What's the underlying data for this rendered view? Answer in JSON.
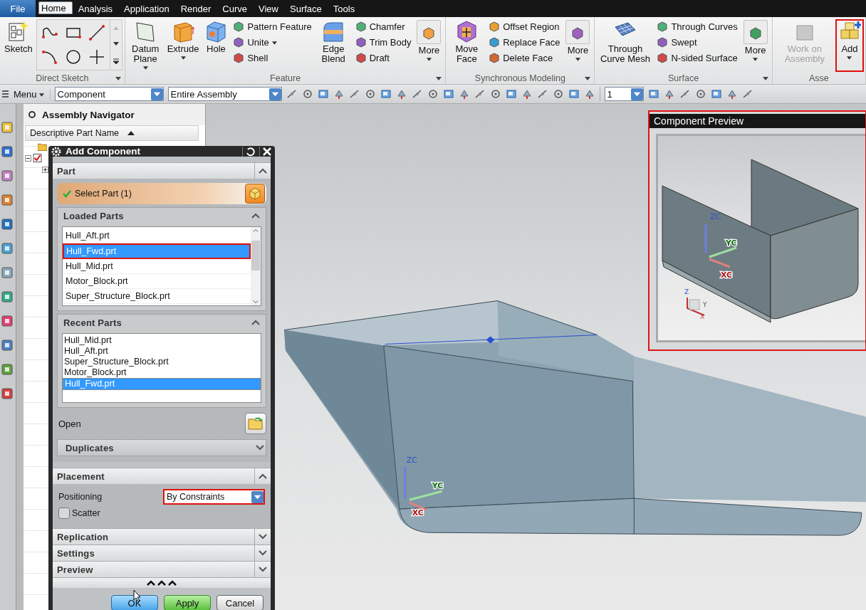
{
  "menu_tabs": [
    {
      "label": "File",
      "kind": "file",
      "selected": false
    },
    {
      "label": "Home",
      "kind": "tab",
      "selected": true
    },
    {
      "label": "Analysis",
      "kind": "tab",
      "selected": false
    },
    {
      "label": "Application",
      "kind": "tab",
      "selected": false
    },
    {
      "label": "Render",
      "kind": "tab",
      "selected": false
    },
    {
      "label": "Curve",
      "kind": "tab",
      "selected": false
    },
    {
      "label": "View",
      "kind": "tab",
      "selected": false
    },
    {
      "label": "Surface",
      "kind": "tab",
      "selected": false
    },
    {
      "label": "Tools",
      "kind": "tab",
      "selected": false
    }
  ],
  "ribbon": [
    {
      "label": "Direct Sketch",
      "items": [
        {
          "kind": "large",
          "label": "Sketch",
          "dropdown": false,
          "disabled": false,
          "highlighted": false
        },
        {
          "kind": "sketch_tools"
        }
      ]
    },
    {
      "label": "Feature",
      "items": [
        {
          "kind": "large",
          "label": "Datum Plane",
          "dropdown": true,
          "disabled": false,
          "highlighted": false
        },
        {
          "kind": "large",
          "label": "Extrude",
          "dropdown": true,
          "disabled": false,
          "highlighted": false
        },
        {
          "kind": "large",
          "label": "Hole",
          "dropdown": false,
          "disabled": false,
          "highlighted": false
        },
        {
          "kind": "stack",
          "items": [
            {
              "label": "Pattern Feature",
              "dropdown": false
            },
            {
              "label": "Unite",
              "dropdown": true
            },
            {
              "label": "Shell",
              "dropdown": false
            }
          ]
        },
        {
          "kind": "large",
          "label": "Edge Blend",
          "dropdown": false,
          "disabled": false,
          "highlighted": false
        },
        {
          "kind": "stack",
          "items": [
            {
              "label": "Chamfer",
              "dropdown": false
            },
            {
              "label": "Trim Body",
              "dropdown": false
            },
            {
              "label": "Draft",
              "dropdown": false
            }
          ]
        },
        {
          "kind": "more",
          "label": "More"
        }
      ]
    },
    {
      "label": "Synchronous Modeling",
      "items": [
        {
          "kind": "large",
          "label": "Move Face",
          "dropdown": false,
          "disabled": false,
          "highlighted": false
        },
        {
          "kind": "stack",
          "items": [
            {
              "label": "Offset Region",
              "dropdown": false
            },
            {
              "label": "Replace Face",
              "dropdown": false
            },
            {
              "label": "Delete Face",
              "dropdown": false
            }
          ]
        },
        {
          "kind": "more",
          "label": "More"
        }
      ]
    },
    {
      "label": "Surface",
      "items": [
        {
          "kind": "large",
          "label": "Through Curve Mesh",
          "dropdown": false,
          "disabled": false,
          "highlighted": false
        },
        {
          "kind": "stack",
          "items": [
            {
              "label": "Through Curves",
              "dropdown": false
            },
            {
              "label": "Swept",
              "dropdown": false
            },
            {
              "label": "N-sided Surface",
              "dropdown": false
            }
          ]
        },
        {
          "kind": "more",
          "label": "More"
        }
      ]
    },
    {
      "label": "Asse",
      "items": [
        {
          "kind": "large",
          "label": "Work on Assembly",
          "dropdown": false,
          "disabled": true,
          "highlighted": false
        },
        {
          "kind": "large",
          "label": "Add",
          "dropdown": true,
          "disabled": false,
          "highlighted": true
        }
      ]
    }
  ],
  "toolbar": {
    "menu": "Menu",
    "selection_filter": "Component",
    "scope": "Entire Assembly",
    "layer": "1"
  },
  "navigator": {
    "title": "Assembly Navigator",
    "column": "Descriptive Part Name",
    "rows": [
      {
        "kind": "folder"
      },
      {
        "kind": "part",
        "checked": true,
        "expanded": true,
        "children": [
          {
            "kind": "part",
            "expanded": false
          }
        ]
      }
    ]
  },
  "dialog": {
    "title": "Add Component",
    "sections": [
      {
        "kind": "part",
        "title": "Part",
        "expanded": true,
        "select": {
          "label": "Select Part (1)",
          "done": true
        },
        "loaded": {
          "title": "Loaded Parts",
          "expanded": true,
          "items": [
            {
              "label": "Hull_Aft.prt",
              "selected": false,
              "highlighted": false
            },
            {
              "label": "Hull_Fwd.prt",
              "selected": true,
              "highlighted": true
            },
            {
              "label": "Hull_Mid.prt",
              "selected": false,
              "highlighted": false
            },
            {
              "label": "Motor_Block.prt",
              "selected": false,
              "highlighted": false
            },
            {
              "label": "Super_Structure_Block.prt",
              "selected": false,
              "highlighted": false
            }
          ]
        },
        "recent": {
          "title": "Recent Parts",
          "expanded": true,
          "items": [
            {
              "label": "Hull_Mid.prt",
              "selected": false
            },
            {
              "label": "Hull_Aft.prt",
              "selected": false
            },
            {
              "label": "Super_Structure_Block.prt",
              "selected": false
            },
            {
              "label": "Motor_Block.prt",
              "selected": false
            },
            {
              "label": "Hull_Fwd.prt",
              "selected": true
            }
          ]
        },
        "open_label": "Open",
        "duplicates": {
          "title": "Duplicates",
          "expanded": false
        }
      },
      {
        "kind": "placement",
        "title": "Placement",
        "expanded": true,
        "positioning": {
          "label": "Positioning",
          "value": "By Constraints",
          "highlighted": true
        },
        "scatter": {
          "label": "Scatter",
          "checked": false
        }
      },
      {
        "kind": "plain",
        "title": "Replication",
        "expanded": false
      },
      {
        "kind": "plain",
        "title": "Settings",
        "expanded": false
      },
      {
        "kind": "plain",
        "title": "Preview",
        "expanded": false
      }
    ],
    "buttons": [
      {
        "label": "OK",
        "kind": "ok"
      },
      {
        "label": "Apply",
        "kind": "apply"
      },
      {
        "label": "Cancel",
        "kind": "cancel"
      }
    ]
  },
  "preview": {
    "title": "Component Preview",
    "highlighted": true,
    "axes": [
      "ZC",
      "YC",
      "XC"
    ],
    "triad": [
      "Z",
      "Y",
      "X"
    ]
  },
  "viewport": {
    "axes": [
      "ZC",
      "YC",
      "XC"
    ]
  }
}
